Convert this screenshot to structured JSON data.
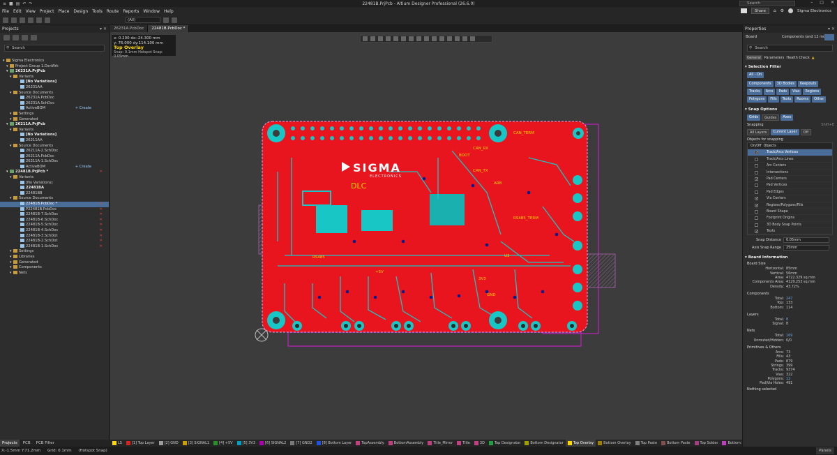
{
  "window": {
    "title": "22481B.PrjPcb - Altium Designer Professional (26.6.0)",
    "search_placeholder": "Search"
  },
  "menu": [
    "File",
    "Edit",
    "View",
    "Project",
    "Place",
    "Design",
    "Tools",
    "Route",
    "Reports",
    "Window",
    "Help"
  ],
  "menu_right": {
    "share": "Share",
    "account": "Sigma Electronics"
  },
  "toolbar": {
    "filter_combo": "(All)"
  },
  "projects_panel": {
    "title": "Projects",
    "search_placeholder": "Search",
    "tree": [
      {
        "label": "Sigma Electronics",
        "indent": 0,
        "style": "normal",
        "icon": "ws"
      },
      {
        "label": "Project Group 1.DsnWrk",
        "indent": 1,
        "style": "normal",
        "icon": "ws"
      },
      {
        "label": "26231A.PrjPcb",
        "indent": 1,
        "style": "bold",
        "icon": "prj"
      },
      {
        "label": "Variants",
        "indent": 2,
        "style": "normal",
        "icon": "fold"
      },
      {
        "label": "[No Variations]",
        "indent": 4,
        "style": "bold",
        "icon": "doc"
      },
      {
        "label": "26231AA",
        "indent": 4,
        "style": "normal",
        "icon": "doc"
      },
      {
        "label": "Source Documents",
        "indent": 2,
        "style": "normal",
        "icon": "fold"
      },
      {
        "label": "26231A.PcbDoc",
        "indent": 4,
        "style": "normal",
        "icon": "doc"
      },
      {
        "label": "26231A.SchDoc",
        "indent": 4,
        "style": "normal",
        "icon": "doc"
      },
      {
        "label": "ActiveBOM",
        "indent": 4,
        "style": "normal",
        "icon": "doc",
        "extra": "+ Create"
      },
      {
        "label": "Settings",
        "indent": 2,
        "style": "normal",
        "icon": "fold"
      },
      {
        "label": "Generated",
        "indent": 2,
        "style": "normal",
        "icon": "fold"
      },
      {
        "label": "26211A.PrjPcb",
        "indent": 1,
        "style": "bold",
        "icon": "prj"
      },
      {
        "label": "Variants",
        "indent": 2,
        "style": "normal",
        "icon": "fold"
      },
      {
        "label": "[No Variations]",
        "indent": 4,
        "style": "bold",
        "icon": "doc"
      },
      {
        "label": "26211AA",
        "indent": 4,
        "style": "normal",
        "icon": "doc"
      },
      {
        "label": "Source Documents",
        "indent": 2,
        "style": "normal",
        "icon": "fold"
      },
      {
        "label": "26211A-2.SchDoc",
        "indent": 4,
        "style": "normal",
        "icon": "doc"
      },
      {
        "label": "26211A.PcbDoc",
        "indent": 4,
        "style": "normal",
        "icon": "doc"
      },
      {
        "label": "26211A-1.SchDoc",
        "indent": 4,
        "style": "normal",
        "icon": "doc"
      },
      {
        "label": "ActiveBOM",
        "indent": 4,
        "style": "normal",
        "icon": "doc",
        "extra": "+ Create"
      },
      {
        "label": "22481B.PrjPcb *",
        "indent": 1,
        "style": "bold",
        "icon": "prj",
        "x": true
      },
      {
        "label": "Variants",
        "indent": 2,
        "style": "normal",
        "icon": "fold"
      },
      {
        "label": "[No Variations]",
        "indent": 4,
        "style": "normal",
        "icon": "doc"
      },
      {
        "label": "22481BA",
        "indent": 4,
        "style": "bold",
        "icon": "doc"
      },
      {
        "label": "22481BB",
        "indent": 4,
        "style": "normal",
        "icon": "doc"
      },
      {
        "label": "Source Documents",
        "indent": 2,
        "style": "normal",
        "icon": "fold"
      },
      {
        "label": "22481B.PcbDoc *",
        "indent": 4,
        "style": "sel",
        "icon": "doc",
        "x": true
      },
      {
        "label": "P22481B.PcbDoc",
        "indent": 4,
        "style": "normal",
        "icon": "doc",
        "x": true
      },
      {
        "label": "22481B-7.SchDoc",
        "indent": 4,
        "style": "normal",
        "icon": "doc",
        "x": true
      },
      {
        "label": "22481B-6.SchDoc",
        "indent": 4,
        "style": "normal",
        "icon": "doc",
        "x": true
      },
      {
        "label": "22481B-5.SchDoc",
        "indent": 4,
        "style": "normal",
        "icon": "doc",
        "x": true
      },
      {
        "label": "22481B-4.SchDoc",
        "indent": 4,
        "style": "normal",
        "icon": "doc",
        "x": true
      },
      {
        "label": "22481B-3.SchDot",
        "indent": 4,
        "style": "normal",
        "icon": "doc",
        "x": true
      },
      {
        "label": "22481B-2.SchDot",
        "indent": 4,
        "style": "normal",
        "icon": "doc",
        "x": true
      },
      {
        "label": "22481B-1.SchDoc",
        "indent": 4,
        "style": "normal",
        "icon": "doc",
        "x": true
      },
      {
        "label": "Settings",
        "indent": 2,
        "style": "normal",
        "icon": "fold"
      },
      {
        "label": "Libraries",
        "indent": 2,
        "style": "normal",
        "icon": "fold"
      },
      {
        "label": "Generated",
        "indent": 2,
        "style": "normal",
        "icon": "fold"
      },
      {
        "label": "Components",
        "indent": 2,
        "style": "normal",
        "icon": "fold"
      },
      {
        "label": "Nets",
        "indent": 2,
        "style": "normal",
        "icon": "fold"
      }
    ],
    "bottom_tabs": [
      "Projects",
      "PCB",
      "PCB Filter"
    ]
  },
  "doc_tabs": [
    "26231A.PcbDoc",
    "22481B.PcbDoc *"
  ],
  "hud": {
    "line1": "x:  0.200   dx:-24.300  mm",
    "line2": "y: 76.000   dy:114.100  mm",
    "layer": "Top Overlay",
    "snap": "Snap: 0.1mm Hotspot Snap: 0.05mm"
  },
  "pcb": {
    "logo": "SIGMA",
    "logo_sub": "ELECTRONICS",
    "labels": [
      {
        "t": "CAN_TERM",
        "c": "#ffd700"
      },
      {
        "t": "CAN_RX",
        "c": "#ffd700"
      },
      {
        "t": "CAN_TX",
        "c": "#ffd700"
      },
      {
        "t": "BOOT",
        "c": "#ffd700"
      },
      {
        "t": "ARB",
        "c": "#ffd700"
      },
      {
        "t": "RS485_TERM",
        "c": "#ffd700"
      },
      {
        "t": "RS485",
        "c": "#ffd700"
      },
      {
        "t": "DLC",
        "c": "#ffd700"
      },
      {
        "t": "U3",
        "c": "#ffd700"
      },
      {
        "t": "GND",
        "c": "#ffd700"
      },
      {
        "t": "+5V",
        "c": "#ffd700"
      },
      {
        "t": "3V3",
        "c": "#ffd700"
      }
    ]
  },
  "layer_tabs": [
    {
      "name": "LS",
      "color": "#ffd700"
    },
    {
      "name": "[1] Top Layer",
      "color": "#e02020"
    },
    {
      "name": "[2] GND",
      "color": "#9c9c9c"
    },
    {
      "name": "[3] SIGNAL1",
      "color": "#c8a000"
    },
    {
      "name": "[4] +5V",
      "color": "#2a8f2a"
    },
    {
      "name": "[5] 3V3",
      "color": "#00a0c0"
    },
    {
      "name": "[6] SIGNAL2",
      "color": "#b000b0"
    },
    {
      "name": "[7] GND2",
      "color": "#7a7a7a"
    },
    {
      "name": "[8] Bottom Layer",
      "color": "#2050e0"
    },
    {
      "name": "TopAssembly",
      "color": "#c04080"
    },
    {
      "name": "BottomAssembly",
      "color": "#c04080"
    },
    {
      "name": "Title_Mirror",
      "color": "#c04080"
    },
    {
      "name": "Title",
      "color": "#c04080"
    },
    {
      "name": "3D",
      "color": "#c04080"
    },
    {
      "name": "Top Designator",
      "color": "#20a040"
    },
    {
      "name": "Bottom Designator",
      "color": "#a0a000"
    },
    {
      "name": "Top Overlay",
      "color": "#ffd700",
      "active": true
    },
    {
      "name": "Bottom Overlay",
      "color": "#a08000"
    },
    {
      "name": "Top Paste",
      "color": "#808080"
    },
    {
      "name": "Bottom Paste",
      "color": "#805050"
    },
    {
      "name": "Top Solder",
      "color": "#a04080"
    },
    {
      "name": "Bottom So",
      "color": "#c040c0"
    }
  ],
  "properties": {
    "title": "Properties",
    "type": "Board",
    "type_filter": "Components (and 12 more)",
    "search_placeholder": "Search",
    "subtabs": [
      "General",
      "Parameters",
      "Health Check"
    ],
    "selection_filter": {
      "title": "Selection Filter",
      "all_on": "All - On",
      "chips": [
        "Components",
        "3D Bodies",
        "Keepouts",
        "Tracks",
        "Arcs",
        "Pads",
        "Vias",
        "Regions",
        "Polygons",
        "Fills",
        "Texts",
        "Rooms",
        "Other"
      ]
    },
    "snap_options": {
      "title": "Snap Options",
      "chips": [
        "Grids",
        "Guides",
        "Axes"
      ],
      "snapping_label": "Snapping",
      "snapping_hint": "Shift+E",
      "snapping_modes": [
        "All Layers",
        "Current Layer",
        "Off"
      ],
      "objects_label": "Objects for snapping",
      "objects_header": [
        "On/Off",
        "Objects"
      ],
      "objects": [
        {
          "name": "Track/Arcs Vertices",
          "on": true,
          "sel": true
        },
        {
          "name": "Track/Arcs Lines",
          "on": false
        },
        {
          "name": "Arc Centers",
          "on": false
        },
        {
          "name": "Intersections",
          "on": false
        },
        {
          "name": "Pad Centers",
          "on": true
        },
        {
          "name": "Pad Vertices",
          "on": false
        },
        {
          "name": "Pad Edges",
          "on": false
        },
        {
          "name": "Via Centers",
          "on": true
        },
        {
          "name": "Regions/Polygons/Fills",
          "on": true
        },
        {
          "name": "Board Shape",
          "on": false
        },
        {
          "name": "Footprint Origins",
          "on": false
        },
        {
          "name": "3D Body Snap Points",
          "on": false
        },
        {
          "name": "Texts",
          "on": true
        }
      ],
      "snap_distance_label": "Snap Distance",
      "snap_distance": "0.05mm",
      "axis_range_label": "Axis Snap Range",
      "axis_range": "25mm"
    },
    "board_info": {
      "title": "Board Information",
      "board_size_label": "Board Size",
      "board_size": [
        {
          "k": "Horizontal:",
          "v": "85mm"
        },
        {
          "k": "Vertical:",
          "v": "56mm"
        },
        {
          "k": "Area:",
          "v": "4722.329 sq.mm"
        },
        {
          "k": "Components Area:",
          "v": "4129.253 sq.mm"
        },
        {
          "k": "Density:",
          "v": "43.72%"
        }
      ],
      "components_label": "Components",
      "components": [
        {
          "k": "Total:",
          "v": "247",
          "link": true
        },
        {
          "k": "Top:",
          "v": "133"
        },
        {
          "k": "Bottom:",
          "v": "114"
        }
      ],
      "layers_label": "Layers",
      "layers": [
        {
          "k": "Total:",
          "v": "8",
          "link": true
        },
        {
          "k": "Signal:",
          "v": "8"
        }
      ],
      "nets_label": "Nets",
      "nets": [
        {
          "k": "Total:",
          "v": "169",
          "link": true
        },
        {
          "k": "Unrouted/Hidden:",
          "v": "0/0"
        }
      ],
      "prims_label": "Primitives & Others",
      "prims": [
        {
          "k": "Arcs:",
          "v": "73"
        },
        {
          "k": "Fills:",
          "v": "43"
        },
        {
          "k": "Pads:",
          "v": "879"
        },
        {
          "k": "Strings:",
          "v": "399"
        },
        {
          "k": "Tracks:",
          "v": "9374"
        },
        {
          "k": "Vias:",
          "v": "322"
        },
        {
          "k": "Polygons:",
          "v": "12",
          "link": true
        },
        {
          "k": "Pad/Via Holes:",
          "v": "491"
        }
      ]
    },
    "footer": "Nothing selected"
  },
  "status": {
    "coords": "X:-1.5mm Y:71.2mm",
    "grid": "Grid: 0.1mm",
    "snap": "(Hotspot Snap)",
    "panels": "Panels"
  }
}
